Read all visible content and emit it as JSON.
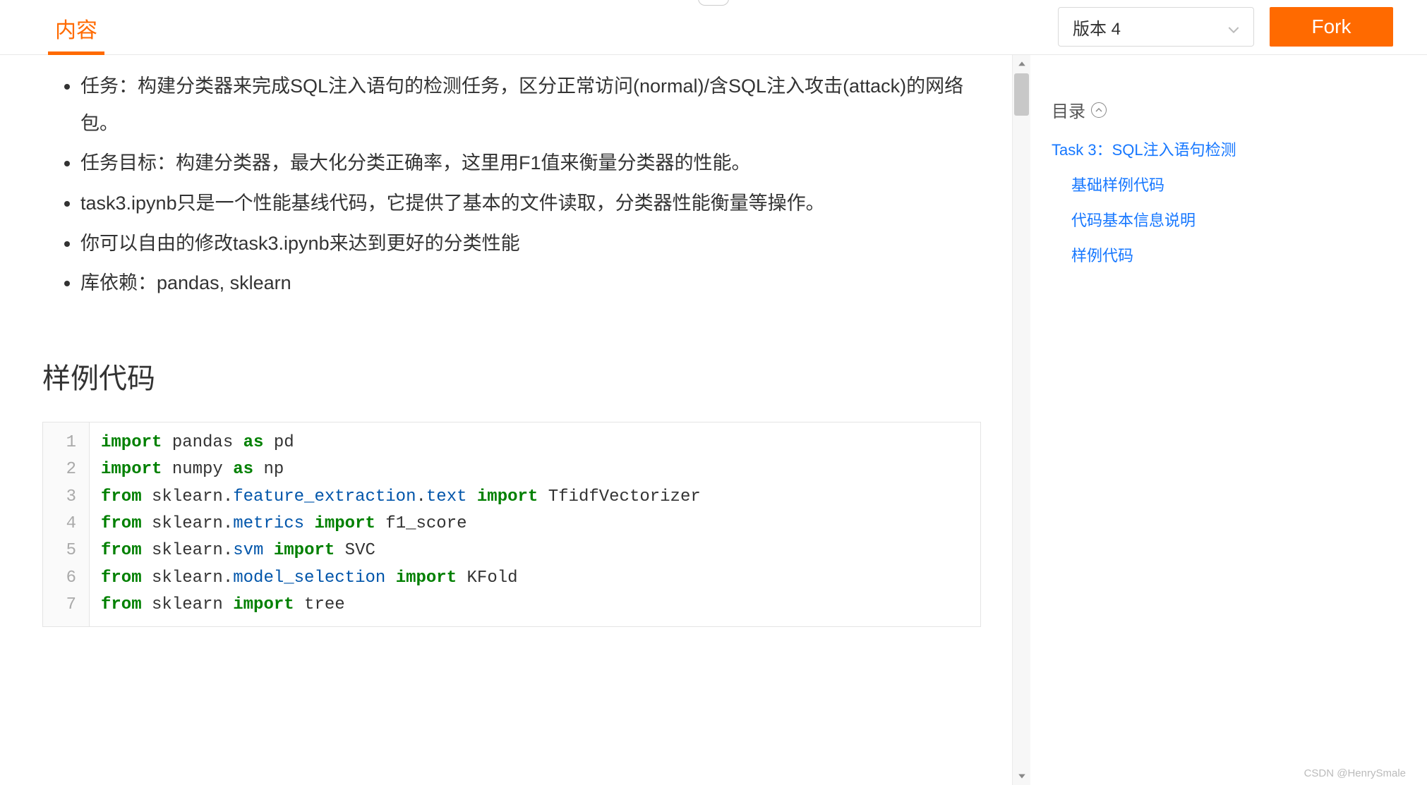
{
  "topbar": {
    "tab_label": "内容",
    "version_label": "版本 4",
    "fork_label": "Fork"
  },
  "bullets": [
    "任务：构建分类器来完成SQL注入语句的检测任务，区分正常访问(normal)/含SQL注入攻击(attack)的网络包。",
    "任务目标：构建分类器，最大化分类正确率，这里用F1值来衡量分类器的性能。",
    "task3.ipynb只是一个性能基线代码，它提供了基本的文件读取，分类器性能衡量等操作。",
    "你可以自由的修改task3.ipynb来达到更好的分类性能",
    "库依赖：pandas, sklearn"
  ],
  "section_heading": "样例代码",
  "code": {
    "line_numbers": [
      "1",
      "2",
      "3",
      "4",
      "5",
      "6",
      "7"
    ],
    "l1": {
      "a": "import",
      "b": " pandas ",
      "c": "as",
      "d": " pd"
    },
    "l2": {
      "a": "import",
      "b": " numpy ",
      "c": "as",
      "d": " np"
    },
    "l3": {
      "a": "from",
      "b": " sklearn.",
      "c": "feature_extraction",
      "d": ".",
      "e": "text",
      "f": " ",
      "g": "import",
      "h": " TfidfVectorizer"
    },
    "l4": {
      "a": "from",
      "b": " sklearn.",
      "c": "metrics",
      "d": " ",
      "e": "import",
      "f": " f1_score"
    },
    "l5": {
      "a": "from",
      "b": " sklearn.",
      "c": "svm",
      "d": " ",
      "e": "import",
      "f": " SVC"
    },
    "l6": {
      "a": "from",
      "b": " sklearn.",
      "c": "model_selection",
      "d": " ",
      "e": "import",
      "f": " KFold"
    },
    "l7": {
      "a": "from",
      "b": " sklearn ",
      "c": "import",
      "d": " tree"
    }
  },
  "toc": {
    "title": "目录",
    "items": [
      {
        "label": "Task 3：SQL注入语句检测",
        "level": 0
      },
      {
        "label": "基础样例代码",
        "level": 1
      },
      {
        "label": "代码基本信息说明",
        "level": 1
      },
      {
        "label": "样例代码",
        "level": 1
      }
    ]
  },
  "watermark": "CSDN @HenrySmale"
}
